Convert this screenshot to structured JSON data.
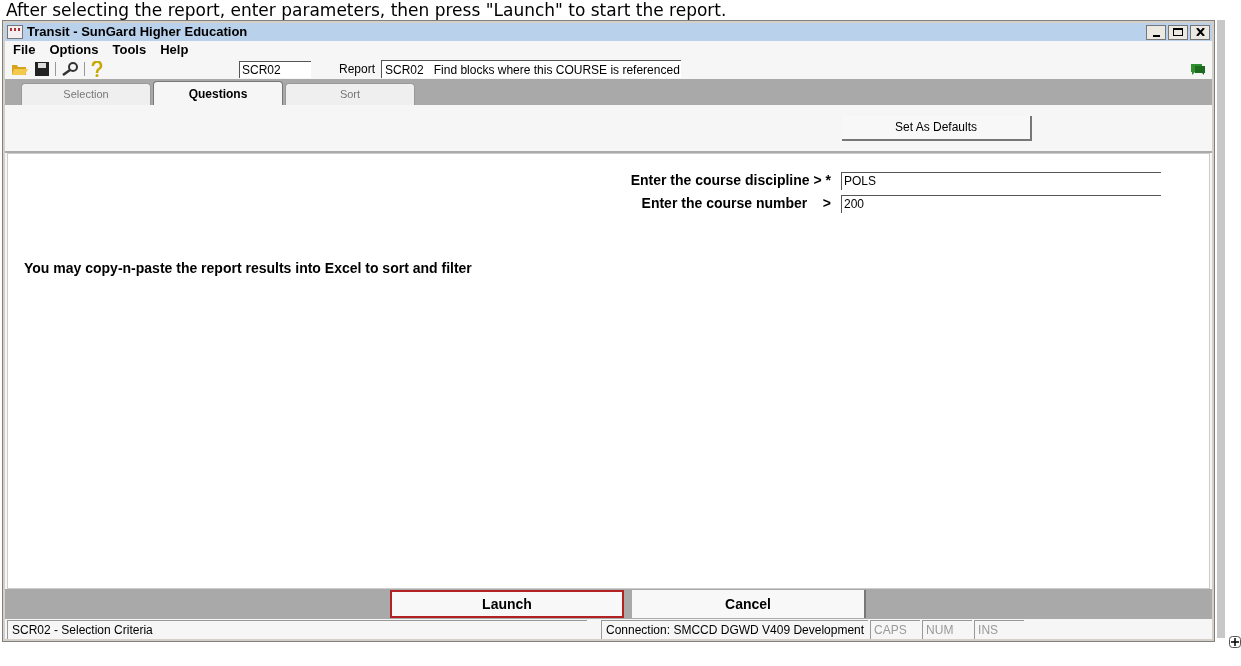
{
  "caption": "After selecting the report, enter parameters, then press \"Launch\" to start the report.",
  "window": {
    "title": "Transit - SunGard Higher Education"
  },
  "menu": [
    "File",
    "Options",
    "Tools",
    "Help"
  ],
  "toolbar": {
    "code": "SCR02",
    "report_label": "Report",
    "report": "SCR02   Find blocks where this COURSE is referenced"
  },
  "tabs": [
    {
      "label": "Selection",
      "selected": false
    },
    {
      "label": "Questions",
      "selected": true
    },
    {
      "label": "Sort",
      "selected": false
    }
  ],
  "defaults_button": "Set As Defaults",
  "questions": [
    {
      "label": "Enter the course discipline > *",
      "value": "POLS"
    },
    {
      "label": "Enter the course number    >",
      "value": "200"
    }
  ],
  "message": "You may copy-n-paste the report results into Excel to sort and filter",
  "buttons": [
    {
      "label": "Launch",
      "highlighted": true
    },
    {
      "label": "Cancel",
      "highlighted": false
    }
  ],
  "status_bar": {
    "left": "SCR02 - Selection Criteria",
    "connection": "Connection: SMCCD DGWD V409 Development",
    "indicators": [
      "CAPS",
      "NUM",
      "INS"
    ]
  }
}
